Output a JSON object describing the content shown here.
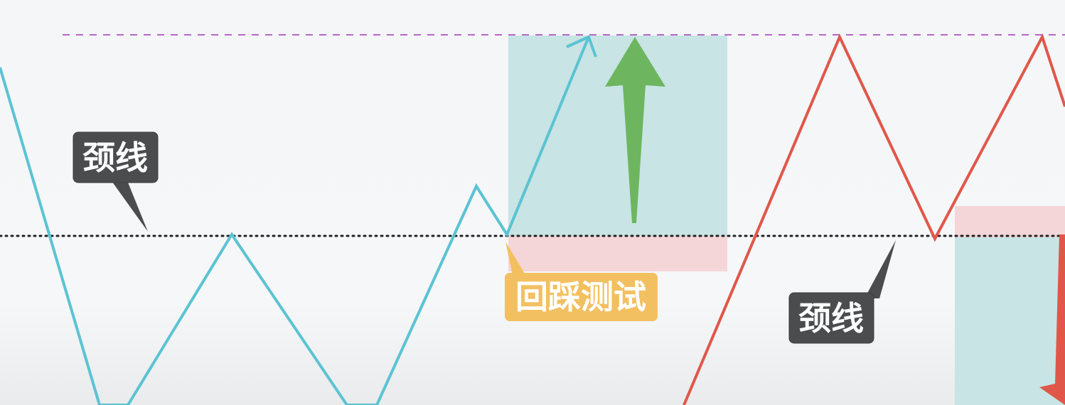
{
  "labels": {
    "neckline_left": "颈线",
    "retest": "回踩测试",
    "neckline_right": "颈线"
  },
  "colors": {
    "bull_line": "#5bc3d3",
    "bear_line": "#e0574a",
    "up_arrow": "#6db65f",
    "target_zone": "#c8e4e4",
    "risk_zone": "#f4d6d8",
    "callout_dark": "#4a4c4e",
    "callout_retest": "#f3c061",
    "neckline": "#222222",
    "target_line": "#b766c8"
  }
}
